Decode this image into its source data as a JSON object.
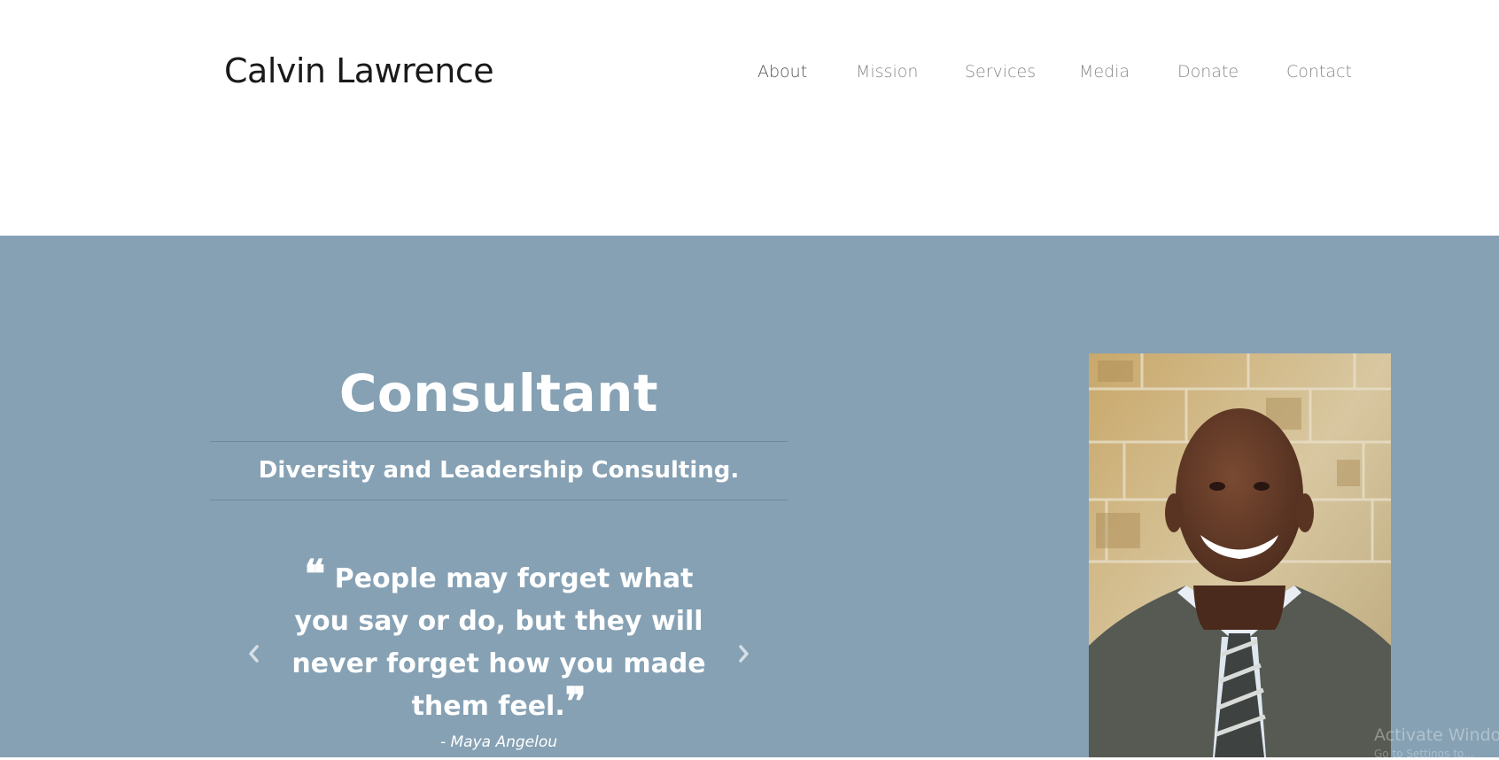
{
  "header": {
    "brand": "Calvin Lawrence",
    "nav": [
      {
        "label": "About"
      },
      {
        "label": "Mission"
      },
      {
        "label": "Services"
      },
      {
        "label": "Media"
      },
      {
        "label": "Donate"
      },
      {
        "label": "Contact"
      }
    ]
  },
  "hero": {
    "title": "Consultant",
    "subtitle": "Diversity and Leadership Consulting.",
    "quote": {
      "open_mark": "❝",
      "text": "People may forget what you say or do, but they will never forget how you made them feel.",
      "close_mark": "❞",
      "author": "- Maya Angelou"
    },
    "prev_icon": "chevron-left-icon",
    "next_icon": "chevron-right-icon",
    "photo_icon": "portrait-photo"
  },
  "overlay": {
    "watermark": "Activate Window",
    "watermark_sub": "Go to Settings to..."
  },
  "colors": {
    "hero_bg": "#86a1b4",
    "brand_text": "#1a1a1a",
    "nav_text": "#8a8a8a"
  }
}
